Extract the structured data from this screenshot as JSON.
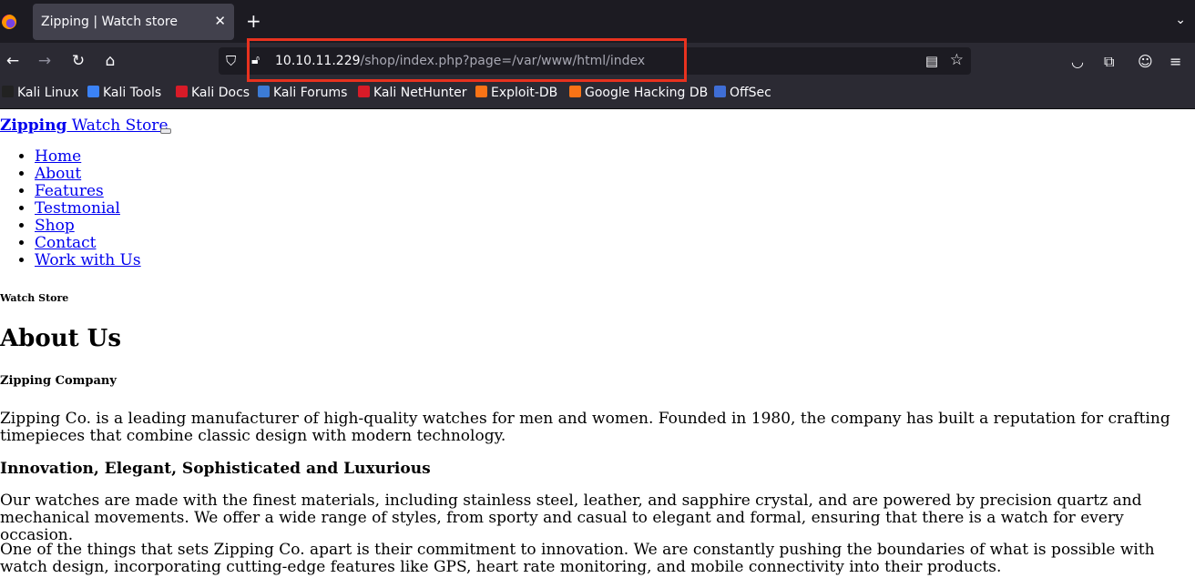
{
  "browser": {
    "tab_title": "Zipping | Watch store",
    "tab_close": "✕",
    "new_tab": "+",
    "tab_list": "⌄",
    "url_host": "10.10.11.229",
    "url_path": "/shop/index.php?page=/var/www/html/index",
    "bookmarks": [
      "Kali Linux",
      "Kali Tools",
      "Kali Docs",
      "Kali Forums",
      "Kali NetHunter",
      "Exploit-DB",
      "Google Hacking DB",
      "OffSec"
    ],
    "bookmark_colors": [
      "#222222",
      "#3b82f6",
      "#d81b28",
      "#3c7bd6",
      "#d81b28",
      "#f97316",
      "#f97316",
      "#3f6ed6"
    ],
    "highlight_color": "#e8321f"
  },
  "page": {
    "brand_bold": "Zipping",
    "brand_rest": " Watch Store",
    "nav": [
      "Home",
      "About",
      "Features",
      "Testmonial",
      "Shop",
      "Contact",
      "Work with Us"
    ],
    "subheading": "Watch Store",
    "heading": "About Us",
    "company": "Zipping Company",
    "para1": "Zipping Co. is a leading manufacturer of high-quality watches for men and women. Founded in 1980, the company has built a reputation for crafting timepieces that combine classic design with modern technology.",
    "tagline": "Innovation, Elegant, Sophisticated and Luxurious",
    "para2": "Our watches are made with the finest materials, including stainless steel, leather, and sapphire crystal, and are powered by precision quartz and mechanical movements. We offer a wide range of styles, from sporty and casual to elegant and formal, ensuring that there is a watch for every occasion.",
    "para3": "One of the things that sets Zipping Co. apart is their commitment to innovation. We are constantly pushing the boundaries of what is possible with watch design, incorporating cutting-edge features like GPS, heart rate monitoring, and mobile connectivity into their products."
  }
}
